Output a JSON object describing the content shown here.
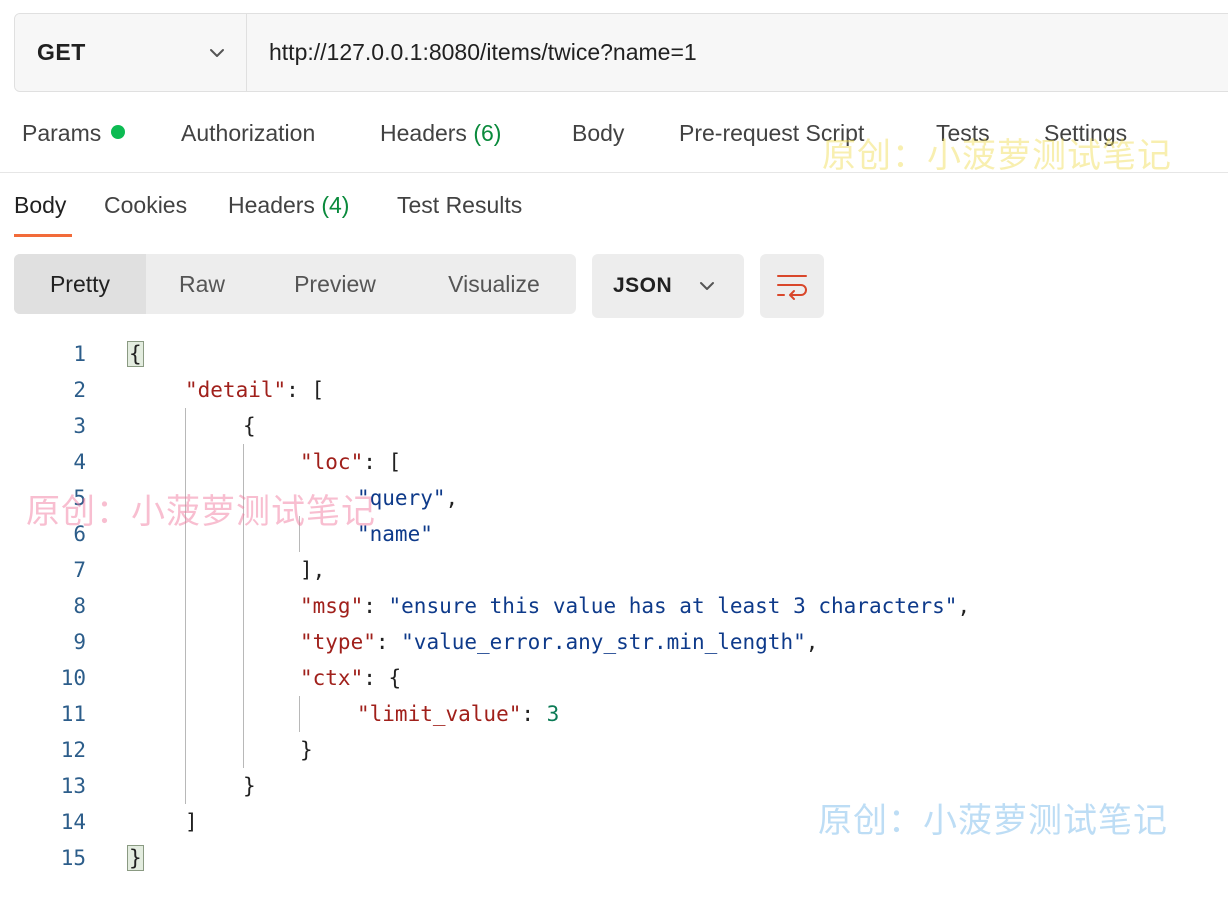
{
  "request": {
    "method": "GET",
    "url": "http://127.0.0.1:8080/items/twice?name=1"
  },
  "request_tabs": {
    "params": "Params",
    "authorization": "Authorization",
    "headers": "Headers",
    "headers_count": "(6)",
    "body": "Body",
    "pre_request_script": "Pre-request Script",
    "tests": "Tests",
    "settings": "Settings"
  },
  "response_tabs": {
    "body": "Body",
    "cookies": "Cookies",
    "headers": "Headers",
    "headers_count": "(4)",
    "test_results": "Test Results"
  },
  "format": {
    "modes": [
      "Pretty",
      "Raw",
      "Preview",
      "Visualize"
    ],
    "active_mode": "Pretty",
    "language": "JSON"
  },
  "code": {
    "line_numbers": [
      "1",
      "2",
      "3",
      "4",
      "5",
      "6",
      "7",
      "8",
      "9",
      "10",
      "11",
      "12",
      "13",
      "14",
      "15"
    ],
    "tokens": {
      "l1_open": "{",
      "detail_key": "\"detail\"",
      "l2_rest": ": [",
      "l3_open": "{",
      "loc_key": "\"loc\"",
      "l4_rest": ": [",
      "query_val": "\"query\"",
      "comma": ",",
      "name_val": "\"name\"",
      "l7_close": "],",
      "msg_key": "\"msg\"",
      "colon": ": ",
      "msg_val": "\"ensure this value has at least 3 characters\"",
      "type_key": "\"type\"",
      "type_val": "\"value_error.any_str.min_length\"",
      "ctx_key": "\"ctx\"",
      "l10_rest": ": {",
      "limit_key": "\"limit_value\"",
      "limit_val": "3",
      "l12_close": "}",
      "l13_close": "}",
      "l14_close": "]",
      "l15_close": "}"
    }
  },
  "watermarks": {
    "text": "原创：小菠萝测试笔记"
  },
  "colors": {
    "accent_underline": "#f26b3a",
    "params_dot": "#0cbb52",
    "count_green": "#0a8a3c",
    "json_key": "#a0201b",
    "json_string": "#0e3a8a",
    "json_number": "#0b7a55",
    "wrap_icon": "#d9472b"
  },
  "icons": {
    "method_dropdown": "chevron-down-icon",
    "language_dropdown": "chevron-down-icon",
    "wrap_lines": "wrap-lines-icon"
  }
}
